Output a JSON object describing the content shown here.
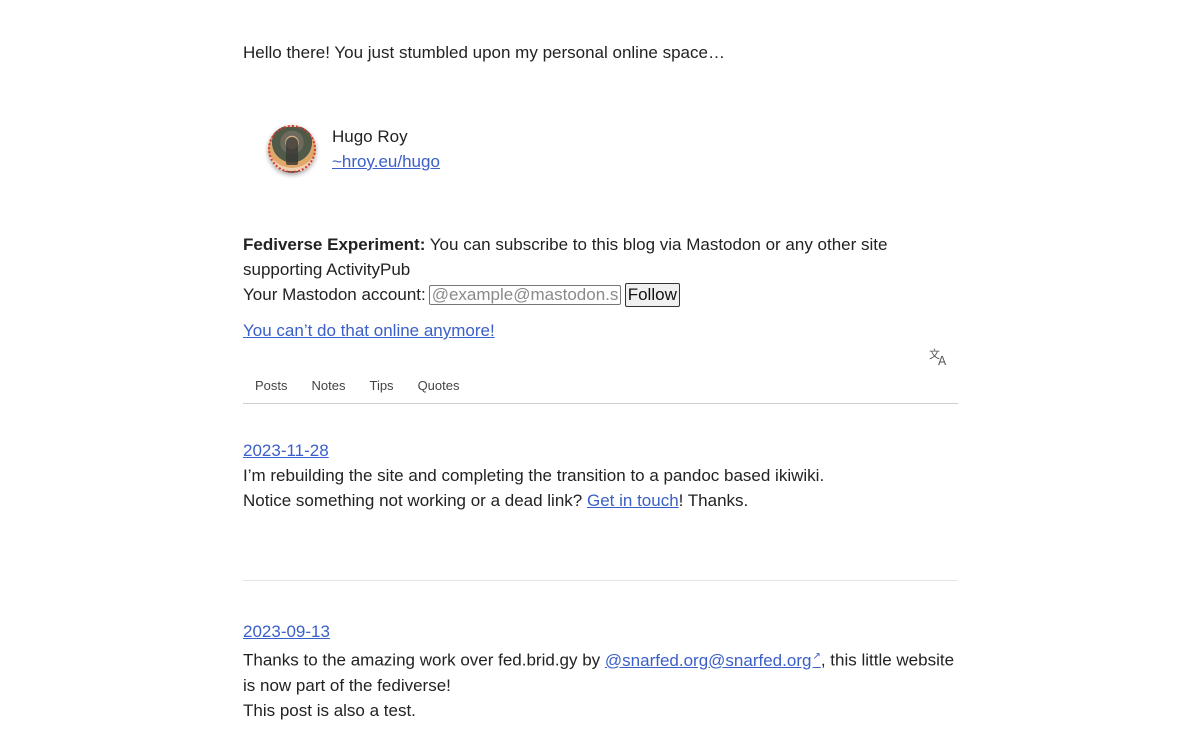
{
  "intro": "Hello there! You just stumbled upon my personal online space…",
  "profile": {
    "name": "Hugo Roy",
    "handle": "~hroy.eu/hugo"
  },
  "fediverse": {
    "label": "Fediverse Experiment:",
    "text": "You can subscribe to this blog via Mastodon or any other site supporting ActivityPub",
    "account_label": "Your Mastodon account:",
    "placeholder": "@example@mastodon.social",
    "follow_button": "Follow"
  },
  "cant_link": "You can’t do that online anymore!",
  "icons": {
    "translate": "translate-icon",
    "external": "external-link-icon"
  },
  "tabs": [
    "Posts",
    "Notes",
    "Tips",
    "Quotes"
  ],
  "posts": [
    {
      "date": "2023-11-28",
      "line1": "I’m rebuilding the site and completing the transition to a pandoc based ikiwiki.",
      "line2_pre": "Notice something not working or a dead link?",
      "line2_link": "Get in touch",
      "line2_post": "! Thanks."
    },
    {
      "date": "2023-09-13",
      "line1_pre": "Thanks to the amazing work over fed.brid.gy by",
      "line1_link": "@snarfed.org@snarfed.org",
      "line1_post": ", this little website is now part of the fediverse!",
      "line2": "This post is also a test."
    }
  ],
  "colors": {
    "link": "#3a5fc8",
    "text": "#222222",
    "divider": "#e6e6e6"
  }
}
